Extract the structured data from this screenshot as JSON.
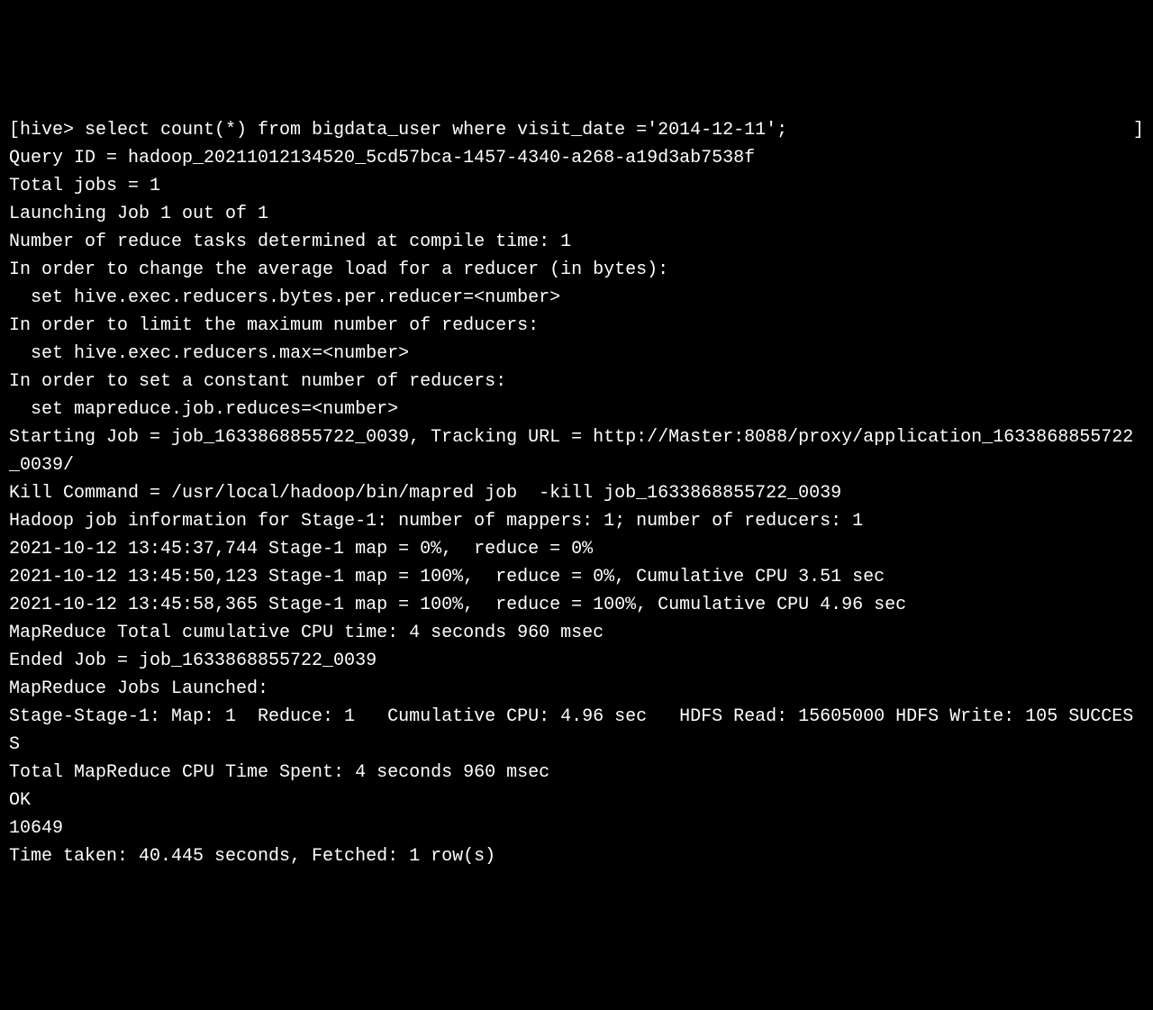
{
  "terminal": {
    "prompt_prefix": "[hive>",
    "command": " select count(*) from bigdata_user where visit_date ='2014-12-11';",
    "prompt_suffix_bracket": "]",
    "lines": [
      "Query ID = hadoop_20211012134520_5cd57bca-1457-4340-a268-a19d3ab7538f",
      "Total jobs = 1",
      "Launching Job 1 out of 1",
      "Number of reduce tasks determined at compile time: 1",
      "In order to change the average load for a reducer (in bytes):",
      "  set hive.exec.reducers.bytes.per.reducer=<number>",
      "In order to limit the maximum number of reducers:",
      "  set hive.exec.reducers.max=<number>",
      "In order to set a constant number of reducers:",
      "  set mapreduce.job.reduces=<number>",
      "Starting Job = job_1633868855722_0039, Tracking URL = http://Master:8088/proxy/application_1633868855722_0039/",
      "Kill Command = /usr/local/hadoop/bin/mapred job  -kill job_1633868855722_0039",
      "Hadoop job information for Stage-1: number of mappers: 1; number of reducers: 1",
      "2021-10-12 13:45:37,744 Stage-1 map = 0%,  reduce = 0%",
      "2021-10-12 13:45:50,123 Stage-1 map = 100%,  reduce = 0%, Cumulative CPU 3.51 sec",
      "2021-10-12 13:45:58,365 Stage-1 map = 100%,  reduce = 100%, Cumulative CPU 4.96 sec",
      "MapReduce Total cumulative CPU time: 4 seconds 960 msec",
      "Ended Job = job_1633868855722_0039",
      "MapReduce Jobs Launched:",
      "Stage-Stage-1: Map: 1  Reduce: 1   Cumulative CPU: 4.96 sec   HDFS Read: 15605000 HDFS Write: 105 SUCCESS",
      "Total MapReduce CPU Time Spent: 4 seconds 960 msec",
      "OK",
      "10649",
      "Time taken: 40.445 seconds, Fetched: 1 row(s)"
    ]
  }
}
